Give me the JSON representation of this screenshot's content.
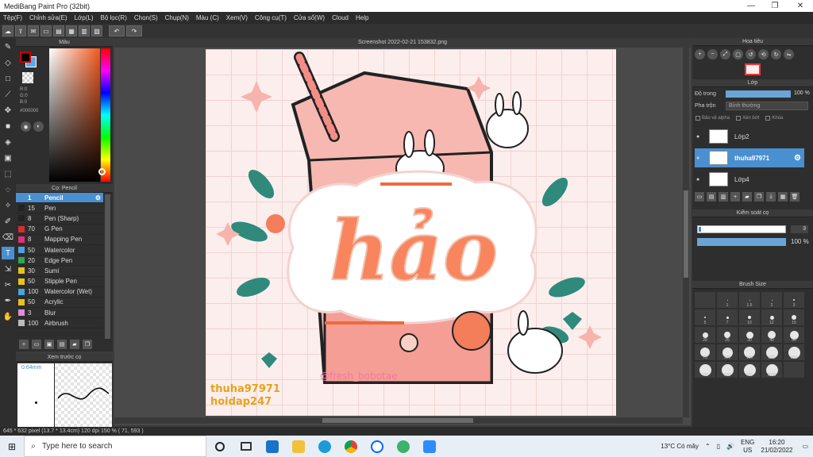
{
  "window": {
    "title": "MediBang Paint Pro (32bit)",
    "min": "—",
    "max": "❐",
    "close": "✕"
  },
  "menu": [
    "Tệp(F)",
    "Chỉnh sửa(E)",
    "Lớp(L)",
    "Bộ lọc(R)",
    "Chọn(S)",
    "Chụp(N)",
    "Màu (C)",
    "Xem(V)",
    "Công cụ(T)",
    "Cửa sổ(W)",
    "Cloud",
    "Help"
  ],
  "toolbar": {
    "undo": "↶",
    "redo": "↷"
  },
  "color_panel": {
    "title": "Màu",
    "r": "R:0",
    "g": "G:0",
    "b": "B:0",
    "hex": "#000000"
  },
  "brush_panel": {
    "title": "Cọ: Pencil",
    "items": [
      {
        "size": "1",
        "name": "Pencil",
        "color": "#4a8fd0"
      },
      {
        "size": "15",
        "name": "Pen",
        "color": "#222222"
      },
      {
        "size": "8",
        "name": "Pen (Sharp)",
        "color": "#222222"
      },
      {
        "size": "70",
        "name": "G Pen",
        "color": "#d0312d"
      },
      {
        "size": "8",
        "name": "Mapping Pen",
        "color": "#e0307a"
      },
      {
        "size": "50",
        "name": "Watercolor",
        "color": "#4aa3df"
      },
      {
        "size": "20",
        "name": "Edge Pen",
        "color": "#2fa84f"
      },
      {
        "size": "30",
        "name": "Sumi",
        "color": "#e8c31a"
      },
      {
        "size": "50",
        "name": "Stipple Pen",
        "color": "#e8c31a"
      },
      {
        "size": "100",
        "name": "Watercolor (Wet)",
        "color": "#4aa3df"
      },
      {
        "size": "50",
        "name": "Acrylic",
        "color": "#e8c31a"
      },
      {
        "size": "3",
        "name": "Blur",
        "color": "#e58ad8"
      },
      {
        "size": "100",
        "name": "Airbrush",
        "color": "#bbbbbb"
      }
    ]
  },
  "preview_panel": {
    "title": "Xem trước cọ",
    "size": "0.64mm"
  },
  "canvas": {
    "title": "Screenshot 2022-02-21 153832.png",
    "art_text": "hảo",
    "watermark": "@fresh_bobotae",
    "credit1": "thuha97971",
    "credit2": "hoidap247"
  },
  "navigator": {
    "title": "Hoa tiêu"
  },
  "layer_panel": {
    "title": "Lớp",
    "opacity_label": "Độ trong",
    "opacity_value": "100 %",
    "blend_label": "Pha trộn",
    "blend_value": "Bình thường",
    "check_alpha": "Bảo vệ alpha",
    "check_clip": "Xén bớt",
    "check_lock": "Khóa",
    "layers": [
      {
        "name": "Lớp2",
        "selected": false
      },
      {
        "name": "thuha97971",
        "selected": true
      },
      {
        "name": "Lớp4",
        "selected": false
      }
    ]
  },
  "brush_control": {
    "title": "Kiểm soát cọ",
    "size_value": "3",
    "opacity_value": "100 %"
  },
  "brush_size": {
    "title": "Brush Size",
    "sizes": [
      {
        "n": "",
        "d": 0
      },
      {
        "n": "1",
        "d": 1
      },
      {
        "n": "1.5",
        "d": 1
      },
      {
        "n": "2",
        "d": 1
      },
      {
        "n": "3",
        "d": 2
      },
      {
        "n": "5",
        "d": 2
      },
      {
        "n": "7",
        "d": 3
      },
      {
        "n": "10",
        "d": 4
      },
      {
        "n": "12",
        "d": 5
      },
      {
        "n": "15",
        "d": 6
      },
      {
        "n": "20",
        "d": 7
      },
      {
        "n": "25",
        "d": 8
      },
      {
        "n": "30",
        "d": 9
      },
      {
        "n": "40",
        "d": 10
      },
      {
        "n": "50",
        "d": 11
      },
      {
        "n": "70",
        "d": 12
      },
      {
        "n": "100",
        "d": 13
      },
      {
        "n": "150",
        "d": 14
      },
      {
        "n": "200",
        "d": 15
      },
      {
        "n": "300",
        "d": 15
      },
      {
        "n": "400",
        "d": 15
      },
      {
        "n": "500",
        "d": 15
      },
      {
        "n": "700",
        "d": 15
      },
      {
        "n": "1000",
        "d": 15
      },
      {
        "n": "",
        "d": 0
      }
    ]
  },
  "status": "645 * 632 pixel   (13.7 * 13.4cm)   120 dpi   150 %   ( 71, 593 )",
  "taskbar": {
    "search_placeholder": "Type here to search",
    "weather": "13°C  Có mây",
    "lang1": "ENG",
    "lang2": "US",
    "time": "16:20",
    "date": "21/02/2022"
  }
}
